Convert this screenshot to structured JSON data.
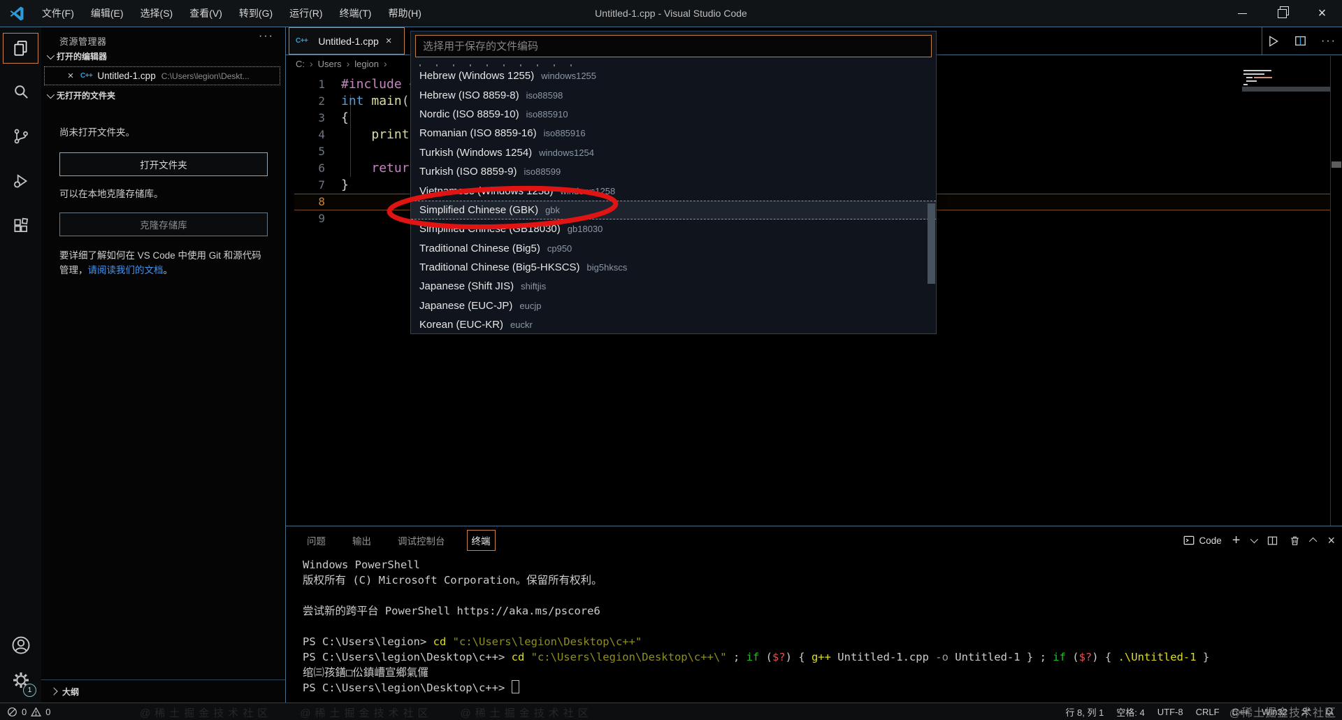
{
  "title_bar": {
    "menus": [
      "文件(F)",
      "编辑(E)",
      "选择(S)",
      "查看(V)",
      "转到(G)",
      "运行(R)",
      "终端(T)",
      "帮助(H)"
    ],
    "title": "Untitled-1.cpp - Visual Studio Code"
  },
  "activity_bar": {
    "items": [
      "explorer",
      "search",
      "source-control",
      "run-and-debug",
      "extensions",
      "account",
      "settings"
    ],
    "active": "explorer",
    "settings_badge": "1"
  },
  "sidebar": {
    "header": "资源管理器",
    "sections": {
      "open_editors": "打开的编辑器",
      "no_folder": "无打开的文件夹",
      "outline": "大纲"
    },
    "open_editor": {
      "file": "Untitled-1.cpp",
      "path": "C:\\Users\\legion\\Deskt...",
      "icon": "cpp-file",
      "language_badge": "C++"
    },
    "no_folder_hint": "尚未打开文件夹。",
    "open_folder_button": "打开文件夹",
    "clone_hint": "可以在本地克隆存储库。",
    "clone_button": "克隆存储库",
    "git_hint_prefix": "要详细了解如何在 VS Code 中使用 Git 和源代码管理，",
    "git_hint_link": "请阅读我们的文档",
    "git_hint_suffix": "。"
  },
  "editor": {
    "tab": {
      "label": "Untitled-1.cpp",
      "language_badge": "C++"
    },
    "breadcrumbs": [
      "C:",
      "Users",
      "legion"
    ],
    "code_lines": [
      {
        "no": "1",
        "tokens": [
          {
            "t": "#include ",
            "c": "mauve"
          },
          {
            "t": "<",
            "c": "plain"
          }
        ]
      },
      {
        "no": "2",
        "tokens": [
          {
            "t": "int ",
            "c": "blue"
          },
          {
            "t": "main",
            "c": "fn"
          },
          {
            "t": "(",
            "c": "plain"
          }
        ]
      },
      {
        "no": "3",
        "tokens": [
          {
            "t": "{",
            "c": "plain"
          }
        ]
      },
      {
        "no": "4",
        "tokens": [
          {
            "t": "    ",
            "c": "plain"
          },
          {
            "t": "printf",
            "c": "fn"
          }
        ]
      },
      {
        "no": "5",
        "tokens": []
      },
      {
        "no": "6",
        "tokens": [
          {
            "t": "    ",
            "c": "plain"
          },
          {
            "t": "return",
            "c": "mauve"
          }
        ]
      },
      {
        "no": "7",
        "tokens": [
          {
            "t": "}",
            "c": "plain"
          }
        ]
      },
      {
        "no": "8",
        "active": true,
        "tokens": []
      },
      {
        "no": "9",
        "tokens": []
      }
    ],
    "cursor_line": "8"
  },
  "quick_pick": {
    "placeholder": "选择用于保存的文件编码",
    "focused_index": 7,
    "items": [
      {
        "label": "Hebrew (Windows 1255)",
        "detail": "windows1255"
      },
      {
        "label": "Hebrew (ISO 8859-8)",
        "detail": "iso88598"
      },
      {
        "label": "Nordic (ISO 8859-10)",
        "detail": "iso885910"
      },
      {
        "label": "Romanian (ISO 8859-16)",
        "detail": "iso885916"
      },
      {
        "label": "Turkish (Windows 1254)",
        "detail": "windows1254"
      },
      {
        "label": "Turkish (ISO 8859-9)",
        "detail": "iso88599"
      },
      {
        "label": "Vietnamese (Windows 1258)",
        "detail": "windows1258"
      },
      {
        "label": "Simplified Chinese (GBK)",
        "detail": "gbk"
      },
      {
        "label": "Simplified Chinese (GB18030)",
        "detail": "gb18030"
      },
      {
        "label": "Traditional Chinese (Big5)",
        "detail": "cp950"
      },
      {
        "label": "Traditional Chinese (Big5-HKSCS)",
        "detail": "big5hkscs"
      },
      {
        "label": "Japanese (Shift JIS)",
        "detail": "shiftjis"
      },
      {
        "label": "Japanese (EUC-JP)",
        "detail": "eucjp"
      },
      {
        "label": "Korean (EUC-KR)",
        "detail": "euckr"
      }
    ]
  },
  "panel": {
    "tabs": [
      "问题",
      "输出",
      "调试控制台",
      "终端"
    ],
    "active_tab": "终端",
    "terminal_name": "Code",
    "terminal_lines": [
      [
        {
          "t": "Windows PowerShell",
          "c": "w"
        }
      ],
      [
        {
          "t": "版权所有 (C) Microsoft Corporation。保留所有权利。",
          "c": "w"
        }
      ],
      [],
      [
        {
          "t": "尝试新的跨平台 PowerShell https://aka.ms/pscore6",
          "c": "w"
        }
      ],
      [],
      [
        {
          "t": "PS C:\\Users\\legion> ",
          "c": "w"
        },
        {
          "t": "cd",
          "c": "y"
        },
        {
          "t": " ",
          "c": "w"
        },
        {
          "t": "\"c:\\Users\\legion\\Desktop\\c++\"",
          "c": "o"
        }
      ],
      [
        {
          "t": "PS C:\\Users\\legion\\Desktop\\c++> ",
          "c": "w"
        },
        {
          "t": "cd",
          "c": "y"
        },
        {
          "t": " ",
          "c": "w"
        },
        {
          "t": "\"c:\\Users\\legion\\Desktop\\c++\\\"",
          "c": "o"
        },
        {
          "t": " ; ",
          "c": "w"
        },
        {
          "t": "if",
          "c": "g"
        },
        {
          "t": " (",
          "c": "w"
        },
        {
          "t": "$?",
          "c": "r"
        },
        {
          "t": ") { ",
          "c": "w"
        },
        {
          "t": "g++",
          "c": "y"
        },
        {
          "t": " Untitled-1.cpp ",
          "c": "w"
        },
        {
          "t": "-o",
          "c": "dim"
        },
        {
          "t": " Untitled-1 } ; ",
          "c": "w"
        },
        {
          "t": "if",
          "c": "g"
        },
        {
          "t": " (",
          "c": "w"
        },
        {
          "t": "$?",
          "c": "r"
        },
        {
          "t": ") { ",
          "c": "w"
        },
        {
          "t": ".\\Untitled-1",
          "c": "y"
        },
        {
          "t": " }",
          "c": "w"
        }
      ],
      [
        {
          "t": "绾㈢孩鐥□伀鎮嶆宣鄉氣儸",
          "c": "w"
        }
      ],
      [
        {
          "t": "PS C:\\Users\\legion\\Desktop\\c++> ",
          "c": "w"
        },
        {
          "t": "",
          "c": "cursor"
        }
      ]
    ]
  },
  "status_bar": {
    "error_count": "0",
    "warning_count": "0",
    "right_items": [
      {
        "name": "cursor-position",
        "label": "行 8, 列 1"
      },
      {
        "name": "indentation",
        "label": "空格: 4"
      },
      {
        "name": "encoding",
        "label": "UTF-8"
      },
      {
        "name": "eol",
        "label": "CRLF"
      },
      {
        "name": "language-mode",
        "label": "C++"
      },
      {
        "name": "platform",
        "label": "Win32"
      }
    ]
  },
  "annotation": {
    "shape": "red-ellipse",
    "target": "Simplified Chinese (GBK)",
    "color": "#e11414"
  },
  "watermark": "@稀土掘金技术社区",
  "icons": {
    "explorer": "files",
    "search": "magnifier",
    "source_control": "git-branch",
    "run_and_debug": "play-bug",
    "extensions": "squares",
    "account": "person-circle",
    "settings": "gear",
    "close": "×",
    "more": "···",
    "run": "▷",
    "split_editor": "side-by-side",
    "new_terminal": "+",
    "terminal_picker": "chevron-down",
    "kill_terminal": "trash",
    "maximize_panel": "chevron-up",
    "minimize": "–",
    "restore": "stacked-squares",
    "error": "circle-slash",
    "warning": "triangle-exclaim",
    "bell": "bell",
    "feedback": "person"
  }
}
